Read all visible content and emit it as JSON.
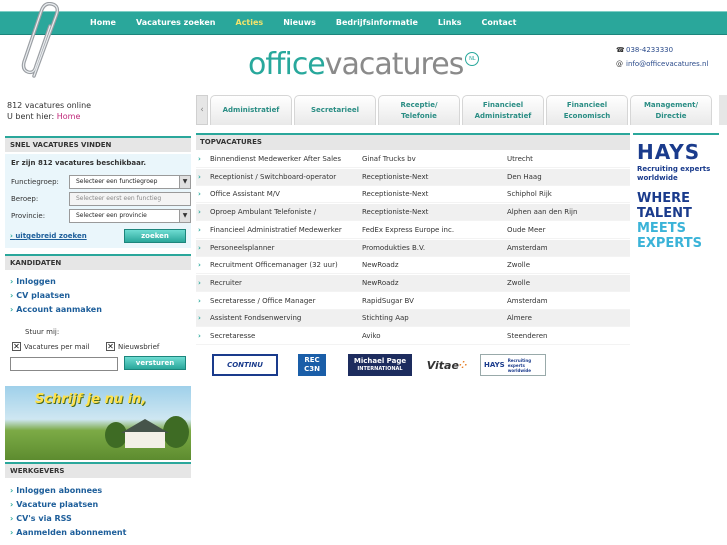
{
  "nav": {
    "items": [
      "Home",
      "Vacatures zoeken",
      "Acties",
      "Nieuws",
      "Bedrijfsinformatie",
      "Links",
      "Contact"
    ],
    "active": "Acties"
  },
  "logo": {
    "part1": "office",
    "part2": "vacatures",
    "badge": "NL"
  },
  "contact": {
    "phone": "038-4233330",
    "email": "info@officevacatures.nl"
  },
  "status": {
    "online": "812 vacatures online",
    "here_label": "U bent hier:",
    "here_link": "Home"
  },
  "categories": [
    {
      "line1": "Administratief",
      "line2": ""
    },
    {
      "line1": "Secretarieel",
      "line2": ""
    },
    {
      "line1": "Receptie/",
      "line2": "Telefonie"
    },
    {
      "line1": "Financieel",
      "line2": "Administratief"
    },
    {
      "line1": "Financieel",
      "line2": "Economisch"
    },
    {
      "line1": "Management/",
      "line2": "Directie"
    }
  ],
  "search": {
    "header": "SNEL VACATURES VINDEN",
    "count_text": "Er zijn 812 vacatures beschikbaar.",
    "fields": [
      {
        "label": "Functiegroep:",
        "value": "Selecteer een functiegroep"
      },
      {
        "label": "Beroep:",
        "value": "Selecteer eerst een functieg"
      },
      {
        "label": "Provincie:",
        "value": "Selecteer een provincie"
      }
    ],
    "advanced": "uitgebreid zoeken",
    "submit": "zoeken"
  },
  "candidates": {
    "header": "KANDIDATEN",
    "links": [
      "Inloggen",
      "CV plaatsen",
      "Account aanmaken"
    ],
    "mail_label": "Stuur mij:",
    "checks": [
      "Vacatures per mail",
      "Nieuwsbrief"
    ],
    "send": "versturen"
  },
  "banner": {
    "text": "Schrijf je nu in,"
  },
  "employers": {
    "header": "WERKGEVERS",
    "links": [
      "Inloggen abonnees",
      "Vacature plaatsen",
      "CV's via RSS",
      "Aanmelden abonnement"
    ]
  },
  "top": {
    "header": "TOPVACATURES",
    "rows": [
      [
        "Binnendienst Medewerker After Sales",
        "Ginaf Trucks bv",
        "Utrecht"
      ],
      [
        "Receptionist / Switchboard-operator",
        "Receptioniste-Next",
        "Den Haag"
      ],
      [
        "Office Assistant M/V",
        "Receptioniste-Next",
        "Schiphol Rijk"
      ],
      [
        "Oproep Ambulant Telefoniste /",
        "Receptioniste-Next",
        "Alphen aan den Rijn"
      ],
      [
        "Financieel Administratief Medewerker",
        "FedEx Express Europe inc.",
        "Oude Meer"
      ],
      [
        "Personeelsplanner",
        "Promodukties B.V.",
        "Amsterdam"
      ],
      [
        "Recruitment Officemanager (32 uur)",
        "NewRoadz",
        "Zwolle"
      ],
      [
        "Recruiter",
        "NewRoadz",
        "Zwolle"
      ],
      [
        "Secretaresse / Office Manager",
        "RapidSugar BV",
        "Amsterdam"
      ],
      [
        "Assistent Fondsenwerving",
        "Stichting Aap",
        "Almere"
      ],
      [
        "Secretaresse",
        "Aviko",
        "Steenderen"
      ]
    ]
  },
  "partners": {
    "continu": "CONTINU",
    "reccen_top": "REC",
    "reccen_bottom": "C3N",
    "michael1": "Michael Page",
    "michael2": "INTERNATIONAL",
    "vitae": "Vitae",
    "hays": "HAYS",
    "hays_sub": "Recruiting experts worldwide"
  },
  "hays_ad": {
    "brand": "HAYS",
    "tag1": "Recruiting experts",
    "tag2": "worldwide",
    "l1": "WHERE",
    "l2": "TALENT",
    "l3": "MEETS",
    "l4": "EXPERTS"
  },
  "colors": {
    "accent": "#2aa79b",
    "link": "#1d5e9a",
    "active_nav": "#f3e36b",
    "hays_blue": "#1a3b8c"
  }
}
